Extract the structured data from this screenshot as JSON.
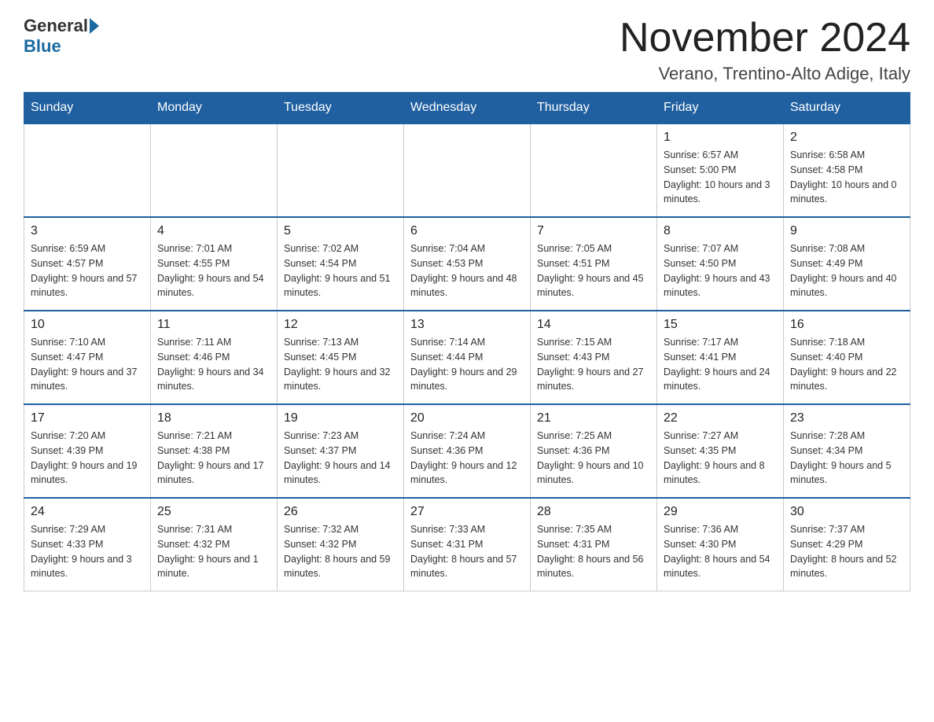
{
  "header": {
    "logo_general": "General",
    "logo_blue": "Blue",
    "month_title": "November 2024",
    "location": "Verano, Trentino-Alto Adige, Italy"
  },
  "days_of_week": [
    "Sunday",
    "Monday",
    "Tuesday",
    "Wednesday",
    "Thursday",
    "Friday",
    "Saturday"
  ],
  "weeks": [
    [
      {
        "day": "",
        "info": ""
      },
      {
        "day": "",
        "info": ""
      },
      {
        "day": "",
        "info": ""
      },
      {
        "day": "",
        "info": ""
      },
      {
        "day": "",
        "info": ""
      },
      {
        "day": "1",
        "info": "Sunrise: 6:57 AM\nSunset: 5:00 PM\nDaylight: 10 hours and 3 minutes."
      },
      {
        "day": "2",
        "info": "Sunrise: 6:58 AM\nSunset: 4:58 PM\nDaylight: 10 hours and 0 minutes."
      }
    ],
    [
      {
        "day": "3",
        "info": "Sunrise: 6:59 AM\nSunset: 4:57 PM\nDaylight: 9 hours and 57 minutes."
      },
      {
        "day": "4",
        "info": "Sunrise: 7:01 AM\nSunset: 4:55 PM\nDaylight: 9 hours and 54 minutes."
      },
      {
        "day": "5",
        "info": "Sunrise: 7:02 AM\nSunset: 4:54 PM\nDaylight: 9 hours and 51 minutes."
      },
      {
        "day": "6",
        "info": "Sunrise: 7:04 AM\nSunset: 4:53 PM\nDaylight: 9 hours and 48 minutes."
      },
      {
        "day": "7",
        "info": "Sunrise: 7:05 AM\nSunset: 4:51 PM\nDaylight: 9 hours and 45 minutes."
      },
      {
        "day": "8",
        "info": "Sunrise: 7:07 AM\nSunset: 4:50 PM\nDaylight: 9 hours and 43 minutes."
      },
      {
        "day": "9",
        "info": "Sunrise: 7:08 AM\nSunset: 4:49 PM\nDaylight: 9 hours and 40 minutes."
      }
    ],
    [
      {
        "day": "10",
        "info": "Sunrise: 7:10 AM\nSunset: 4:47 PM\nDaylight: 9 hours and 37 minutes."
      },
      {
        "day": "11",
        "info": "Sunrise: 7:11 AM\nSunset: 4:46 PM\nDaylight: 9 hours and 34 minutes."
      },
      {
        "day": "12",
        "info": "Sunrise: 7:13 AM\nSunset: 4:45 PM\nDaylight: 9 hours and 32 minutes."
      },
      {
        "day": "13",
        "info": "Sunrise: 7:14 AM\nSunset: 4:44 PM\nDaylight: 9 hours and 29 minutes."
      },
      {
        "day": "14",
        "info": "Sunrise: 7:15 AM\nSunset: 4:43 PM\nDaylight: 9 hours and 27 minutes."
      },
      {
        "day": "15",
        "info": "Sunrise: 7:17 AM\nSunset: 4:41 PM\nDaylight: 9 hours and 24 minutes."
      },
      {
        "day": "16",
        "info": "Sunrise: 7:18 AM\nSunset: 4:40 PM\nDaylight: 9 hours and 22 minutes."
      }
    ],
    [
      {
        "day": "17",
        "info": "Sunrise: 7:20 AM\nSunset: 4:39 PM\nDaylight: 9 hours and 19 minutes."
      },
      {
        "day": "18",
        "info": "Sunrise: 7:21 AM\nSunset: 4:38 PM\nDaylight: 9 hours and 17 minutes."
      },
      {
        "day": "19",
        "info": "Sunrise: 7:23 AM\nSunset: 4:37 PM\nDaylight: 9 hours and 14 minutes."
      },
      {
        "day": "20",
        "info": "Sunrise: 7:24 AM\nSunset: 4:36 PM\nDaylight: 9 hours and 12 minutes."
      },
      {
        "day": "21",
        "info": "Sunrise: 7:25 AM\nSunset: 4:36 PM\nDaylight: 9 hours and 10 minutes."
      },
      {
        "day": "22",
        "info": "Sunrise: 7:27 AM\nSunset: 4:35 PM\nDaylight: 9 hours and 8 minutes."
      },
      {
        "day": "23",
        "info": "Sunrise: 7:28 AM\nSunset: 4:34 PM\nDaylight: 9 hours and 5 minutes."
      }
    ],
    [
      {
        "day": "24",
        "info": "Sunrise: 7:29 AM\nSunset: 4:33 PM\nDaylight: 9 hours and 3 minutes."
      },
      {
        "day": "25",
        "info": "Sunrise: 7:31 AM\nSunset: 4:32 PM\nDaylight: 9 hours and 1 minute."
      },
      {
        "day": "26",
        "info": "Sunrise: 7:32 AM\nSunset: 4:32 PM\nDaylight: 8 hours and 59 minutes."
      },
      {
        "day": "27",
        "info": "Sunrise: 7:33 AM\nSunset: 4:31 PM\nDaylight: 8 hours and 57 minutes."
      },
      {
        "day": "28",
        "info": "Sunrise: 7:35 AM\nSunset: 4:31 PM\nDaylight: 8 hours and 56 minutes."
      },
      {
        "day": "29",
        "info": "Sunrise: 7:36 AM\nSunset: 4:30 PM\nDaylight: 8 hours and 54 minutes."
      },
      {
        "day": "30",
        "info": "Sunrise: 7:37 AM\nSunset: 4:29 PM\nDaylight: 8 hours and 52 minutes."
      }
    ]
  ]
}
